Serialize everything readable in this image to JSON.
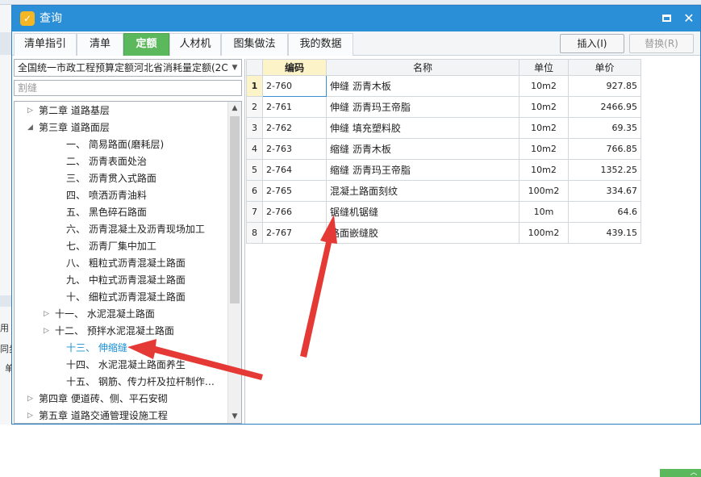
{
  "window": {
    "title": "查询",
    "icon": "app-logo-icon",
    "maximize": "maximize-icon",
    "close": "✕"
  },
  "tabs": [
    {
      "label": "清单指引",
      "active": false
    },
    {
      "label": "清单",
      "active": false
    },
    {
      "label": "定额",
      "active": true
    },
    {
      "label": "人材机",
      "active": false
    },
    {
      "label": "图集做法",
      "active": false
    },
    {
      "label": "我的数据",
      "active": false
    }
  ],
  "toolbar": {
    "insert_label": "插入(I)",
    "replace_label": "替换(R)"
  },
  "left": {
    "combo_value": "全国统一市政工程预算定额河北省消耗量定额(2C",
    "search_placeholder": "割缝",
    "tree": [
      {
        "label": "第二章  道路基层",
        "indent": 1,
        "toggle": "▷"
      },
      {
        "label": "第三章  道路面层",
        "indent": 1,
        "toggle": "◢"
      },
      {
        "label": "一、  简易路面(磨耗层)",
        "indent": 3,
        "toggle": ""
      },
      {
        "label": "二、  沥青表面处治",
        "indent": 3,
        "toggle": ""
      },
      {
        "label": "三、  沥青贯入式路面",
        "indent": 3,
        "toggle": ""
      },
      {
        "label": "四、  喷洒沥青油料",
        "indent": 3,
        "toggle": ""
      },
      {
        "label": "五、  黑色碎石路面",
        "indent": 3,
        "toggle": ""
      },
      {
        "label": "六、  沥青混凝土及沥青现场加工",
        "indent": 3,
        "toggle": ""
      },
      {
        "label": "七、  沥青厂集中加工",
        "indent": 3,
        "toggle": ""
      },
      {
        "label": "八、  粗粒式沥青混凝土路面",
        "indent": 3,
        "toggle": ""
      },
      {
        "label": "九、  中粒式沥青混凝土路面",
        "indent": 3,
        "toggle": ""
      },
      {
        "label": "十、  细粒式沥青混凝土路面",
        "indent": 3,
        "toggle": ""
      },
      {
        "label": "十一、  水泥混凝土路面",
        "indent": 2,
        "toggle": "▷"
      },
      {
        "label": "十二、  预拌水泥混凝土路面",
        "indent": 2,
        "toggle": "▷"
      },
      {
        "label": "十三、  伸缩缝",
        "indent": 3,
        "toggle": "",
        "selected": true
      },
      {
        "label": "十四、  水泥混凝土路面养生",
        "indent": 3,
        "toggle": ""
      },
      {
        "label": "十五、  钢筋、传力杆及拉杆制作…",
        "indent": 3,
        "toggle": ""
      },
      {
        "label": "第四章  便道砖、侧、平石安砌",
        "indent": 1,
        "toggle": "▷"
      },
      {
        "label": "第五章  道路交通管理设施工程",
        "indent": 1,
        "toggle": "▷"
      }
    ]
  },
  "grid": {
    "headers": {
      "code": "编码",
      "name": "名称",
      "unit": "单位",
      "price": "单价"
    },
    "rows": [
      {
        "no": "1",
        "code": "2-760",
        "name": "伸缝 沥青木板",
        "unit": "10m2",
        "price": "927.85"
      },
      {
        "no": "2",
        "code": "2-761",
        "name": "伸缝 沥青玛王帝脂",
        "unit": "10m2",
        "price": "2466.95"
      },
      {
        "no": "3",
        "code": "2-762",
        "name": "伸缝 填充塑料胶",
        "unit": "10m2",
        "price": "69.35"
      },
      {
        "no": "4",
        "code": "2-763",
        "name": "缩缝 沥青木板",
        "unit": "10m2",
        "price": "766.85"
      },
      {
        "no": "5",
        "code": "2-764",
        "name": "缩缝 沥青玛王帝脂",
        "unit": "10m2",
        "price": "1352.25"
      },
      {
        "no": "6",
        "code": "2-765",
        "name": "混凝土路面刻纹",
        "unit": "100m2",
        "price": "334.67"
      },
      {
        "no": "7",
        "code": "2-766",
        "name": "锯缝机锯缝",
        "unit": "10m",
        "price": "64.6"
      },
      {
        "no": "8",
        "code": "2-767",
        "name": "路面嵌缝胶",
        "unit": "100m2",
        "price": "439.15"
      }
    ]
  },
  "background": {
    "left_text_1": "用",
    "left_text_2": "同步",
    "left_text_3": "单"
  },
  "colors": {
    "title_bar": "#2b8fd8",
    "active_tab": "#5cb85c",
    "selected_tree": "#1a8fd6",
    "annotation_arrow": "#e53935"
  }
}
